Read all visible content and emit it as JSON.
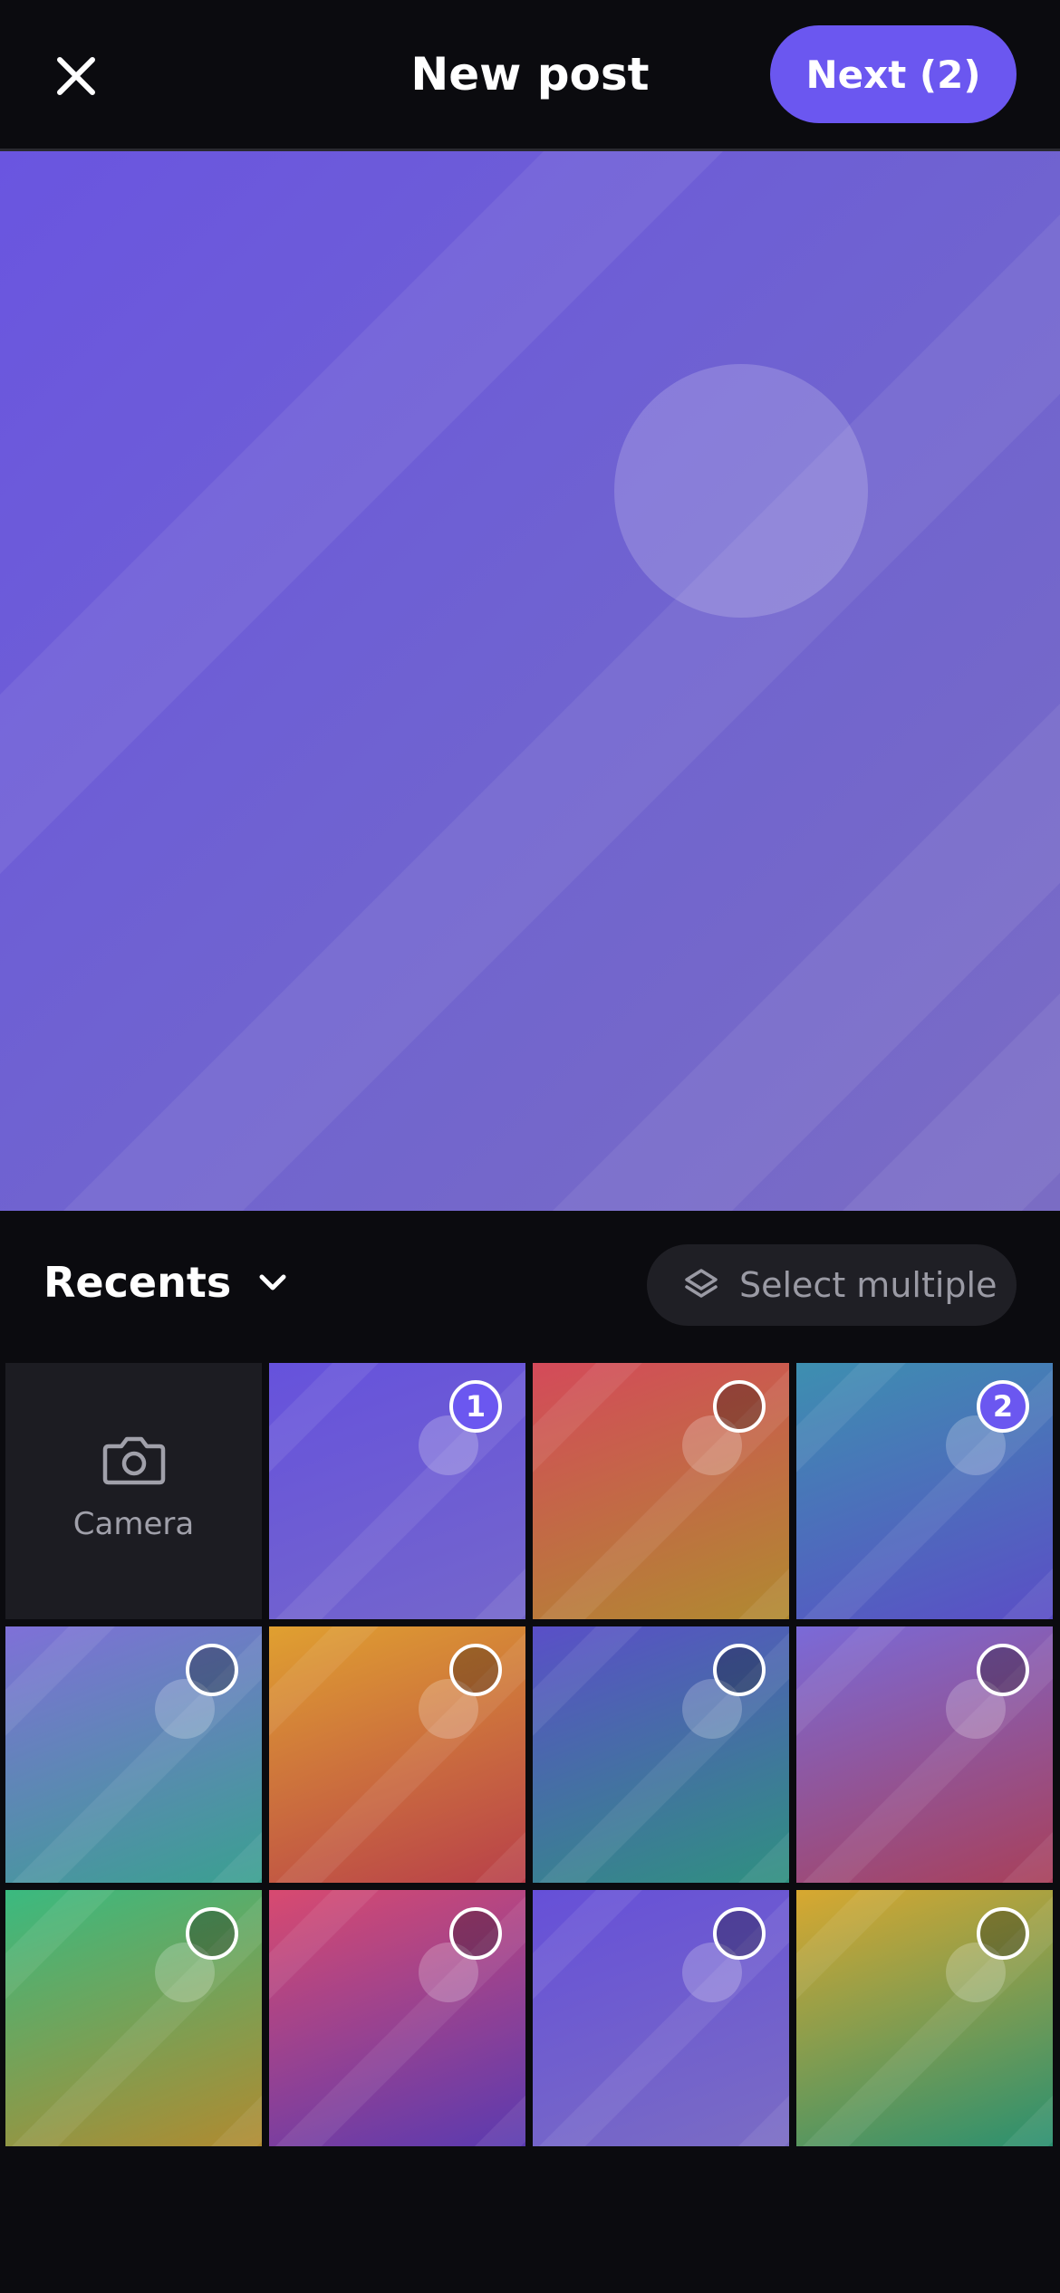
{
  "header": {
    "title": "New post",
    "next_label": "Next (2)"
  },
  "picker": {
    "album_label": "Recents",
    "select_multiple_label": "Select multiple"
  },
  "camera": {
    "label": "Camera"
  },
  "tiles": [
    {
      "gradient": [
        "#6652dc",
        "#7466cc"
      ],
      "selected_index": "1"
    },
    {
      "gradient": [
        "#d44a5a",
        "#b08a30"
      ],
      "selected_index": ""
    },
    {
      "gradient": [
        "#3d8fb0",
        "#5b4ec6"
      ],
      "selected_index": "2"
    },
    {
      "gradient": [
        "#7f70d8",
        "#3aa090"
      ],
      "selected_index": ""
    },
    {
      "gradient": [
        "#e0a030",
        "#b8404a"
      ],
      "selected_index": ""
    },
    {
      "gradient": [
        "#5a4fc8",
        "#2f9080"
      ],
      "selected_index": ""
    },
    {
      "gradient": [
        "#7a6ad8",
        "#a8405a"
      ],
      "selected_index": ""
    },
    {
      "gradient": [
        "#3aba80",
        "#b08a30"
      ],
      "selected_index": ""
    },
    {
      "gradient": [
        "#d84a70",
        "#5a3ab0"
      ],
      "selected_index": ""
    },
    {
      "gradient": [
        "#6650d8",
        "#7a6cc4"
      ],
      "selected_index": ""
    },
    {
      "gradient": [
        "#d8a830",
        "#2a9070"
      ],
      "selected_index": ""
    }
  ],
  "colors": {
    "accent": "#6b57f0",
    "background": "#0b0b0f"
  }
}
